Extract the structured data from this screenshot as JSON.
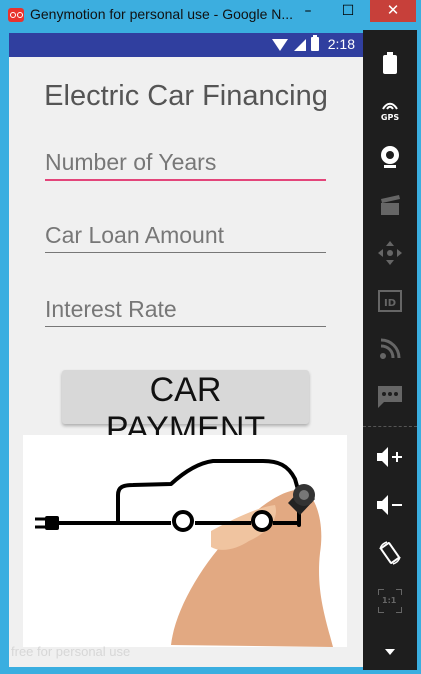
{
  "window": {
    "title": "Genymotion for personal use - Google N...",
    "minimize_glyph": "–",
    "maximize_glyph": "☐",
    "close_glyph": "✕"
  },
  "status_bar": {
    "time": "2:18",
    "icons": [
      "wifi-icon",
      "signal-icon",
      "battery-icon"
    ]
  },
  "app": {
    "title": "Electric Car Financing",
    "fields": [
      {
        "placeholder": "Number of Years",
        "value": ""
      },
      {
        "placeholder": "Car Loan Amount",
        "value": ""
      },
      {
        "placeholder": "Interest Rate",
        "value": ""
      }
    ],
    "button_label": "CAR PAYMENT"
  },
  "watermark": "free for personal use",
  "sidebar": {
    "items": [
      {
        "name": "battery-icon"
      },
      {
        "name": "gps-icon",
        "label": "GPS"
      },
      {
        "name": "webcam-icon"
      },
      {
        "name": "capture-icon"
      },
      {
        "name": "dpad-icon"
      },
      {
        "name": "id-icon",
        "label": "ID"
      },
      {
        "name": "cast-icon"
      },
      {
        "name": "sms-icon"
      },
      {
        "name": "volume-up-icon"
      },
      {
        "name": "volume-down-icon"
      },
      {
        "name": "rotate-icon"
      },
      {
        "name": "pixel-perfect-icon",
        "label": "1:1"
      },
      {
        "name": "scroll-down-icon"
      }
    ]
  },
  "colors": {
    "window_frame": "#3caedf",
    "status_bar": "#303f9f",
    "accent": "#e3457a",
    "close_button": "#c7403a",
    "sidebar": "#1e1e1e"
  }
}
